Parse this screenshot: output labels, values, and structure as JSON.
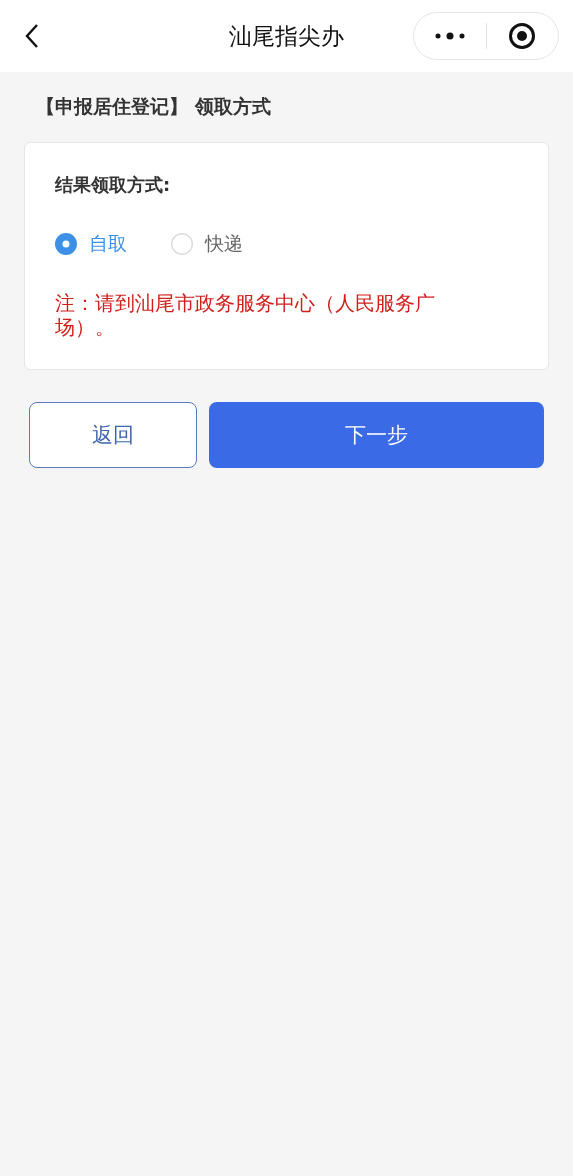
{
  "nav_bar": {
    "title": "汕尾指尖办"
  },
  "page_heading": "【申报居住登记】 领取方式",
  "form": {
    "label": "结果领取方式:",
    "options": [
      {
        "label": "自取",
        "selected": true
      },
      {
        "label": "快递",
        "selected": false
      }
    ],
    "note": "注：请到汕尾市政务服务中心（人民服务广场）。"
  },
  "buttons": [
    {
      "kind": "secondary",
      "label": "返回"
    },
    {
      "kind": "primary",
      "label": "下一步"
    }
  ]
}
